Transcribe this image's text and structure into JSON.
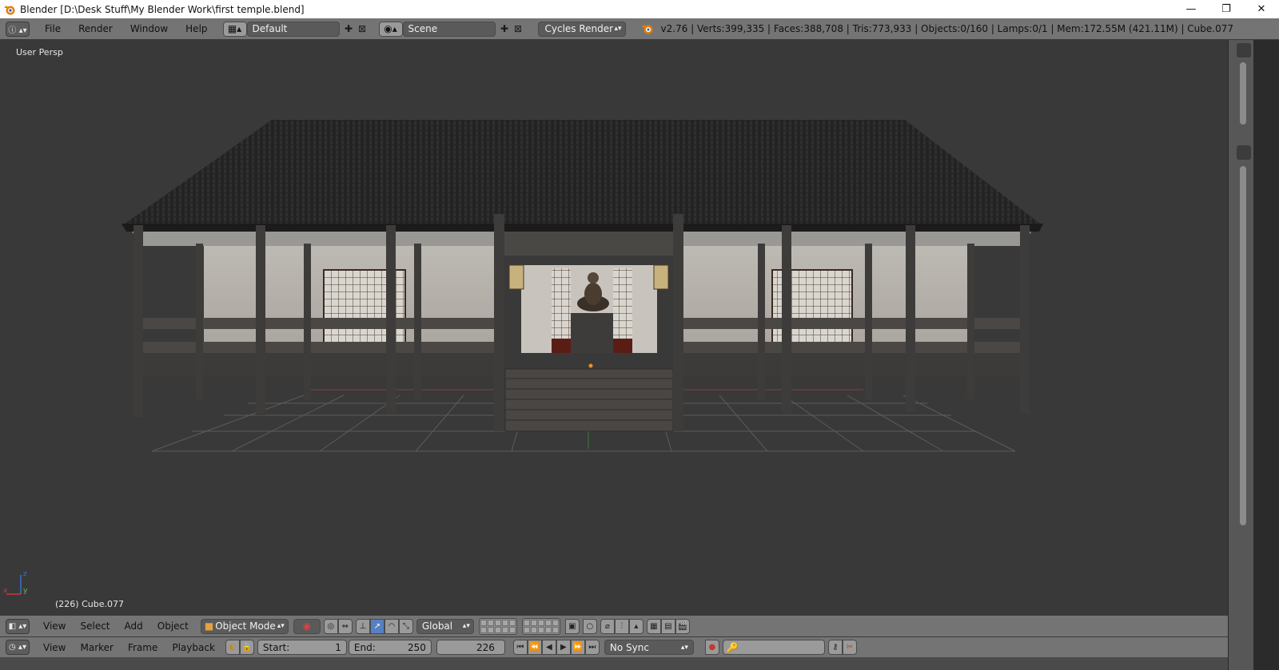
{
  "window": {
    "title": "Blender [D:\\Desk Stuff\\My Blender Work\\first temple.blend]",
    "minimize": "—",
    "restore": "❐",
    "close": "✕"
  },
  "info_header": {
    "menus": [
      "File",
      "Render",
      "Window",
      "Help"
    ],
    "screen_layout": "Default",
    "scene": "Scene",
    "render_engine": "Cycles Render",
    "stats": "v2.76 | Verts:399,335 | Faces:388,708 | Tris:773,933 | Objects:0/160 | Lamps:0/1 | Mem:172.55M (421.11M) | Cube.077"
  },
  "viewport": {
    "view_label": "User Persp",
    "active_object": "(226) Cube.077",
    "axis_labels": {
      "z": "z",
      "y": "y",
      "x": "x"
    }
  },
  "view_header": {
    "menus": [
      "View",
      "Select",
      "Add",
      "Object"
    ],
    "mode": "Object Mode",
    "transform_orientation": "Global"
  },
  "timeline": {
    "menus": [
      "View",
      "Marker",
      "Frame",
      "Playback"
    ],
    "start_label": "Start:",
    "start_value": "1",
    "end_label": "End:",
    "end_value": "250",
    "current_frame": "226",
    "sync": "No Sync"
  },
  "colors": {
    "header_bg": "#747474",
    "viewport_bg": "#393939",
    "accent_blue": "#5680c2",
    "record_red": "#c23a2a",
    "blender_orange": "#e87d0d"
  }
}
